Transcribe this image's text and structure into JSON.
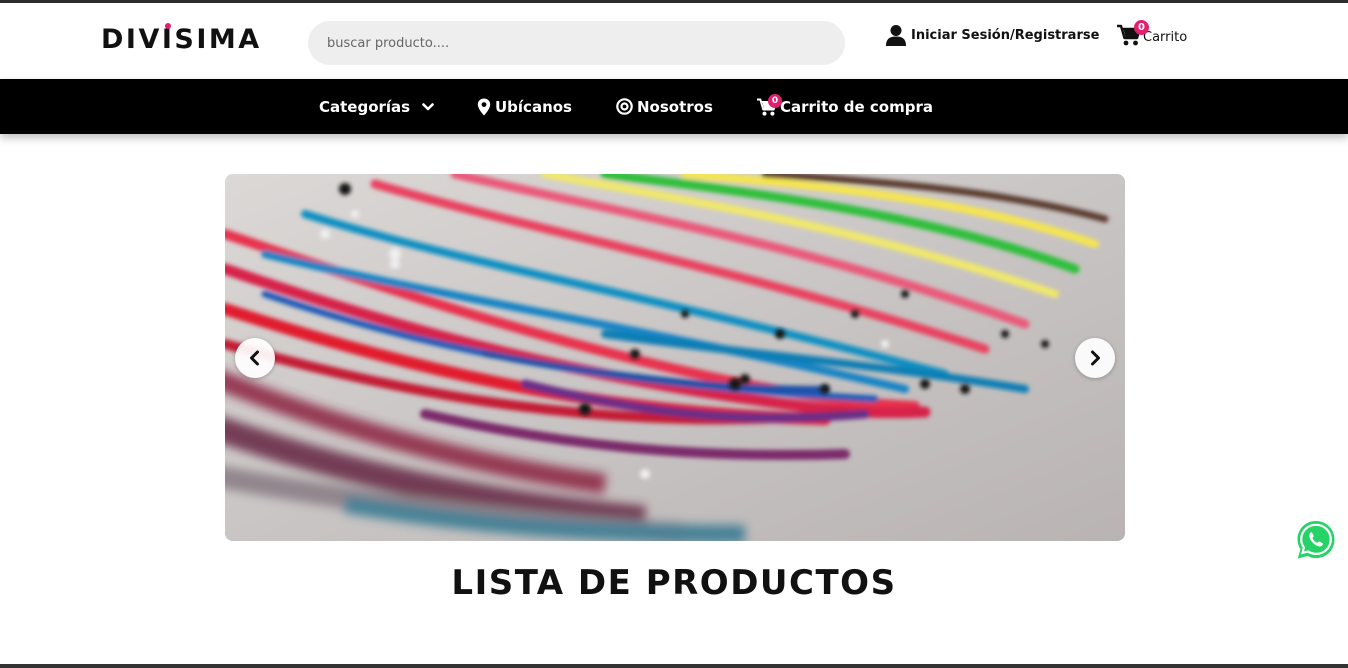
{
  "brand": {
    "name_before_i": "DIV",
    "name_i": "I",
    "name_after_i": "SIMA",
    "accent_color": "#e0206e"
  },
  "header": {
    "search_placeholder": "buscar producto....",
    "login_label": "Iniciar Sesión/Registrarse",
    "login_icon": "user-icon",
    "cart_label": "Carrito",
    "cart_icon": "cart-icon",
    "cart_count": "0"
  },
  "nav": {
    "background": "#000000",
    "items": [
      {
        "label": "Categorías",
        "icon": "chevron-down-icon"
      },
      {
        "label": "Ubícanos",
        "icon": "map-pin-icon"
      },
      {
        "label": "Nosotros",
        "icon": "target-icon"
      },
      {
        "label": "Carrito de compra",
        "icon": "cart-icon",
        "count": "0"
      }
    ]
  },
  "carousel": {
    "prev_icon": "chevron-left-icon",
    "next_icon": "chevron-right-icon"
  },
  "main": {
    "section_title": "LISTA DE PRODUCTOS"
  },
  "floating": {
    "whatsapp_icon": "whatsapp-icon",
    "whatsapp_color": "#25d366"
  }
}
